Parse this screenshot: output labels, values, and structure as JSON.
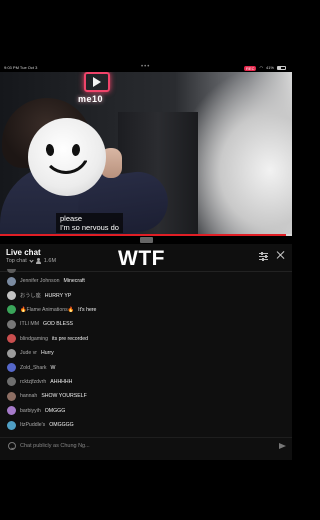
{
  "status_bar": {
    "time_date": "9:03 PM  Tue Oct 3",
    "record_badge": "REC",
    "battery": "41%"
  },
  "video": {
    "neon_sign": "me10",
    "caption_lines": [
      "please",
      "I'm so nervous do"
    ],
    "progress_fraction": 0.98
  },
  "chat": {
    "title": "Live chat",
    "mode_label": "Top chat",
    "viewer_count": "1.6M",
    "overlay_text": "WTF",
    "input_placeholder": "Chat publicly as Chung Ng...",
    "messages": [
      {
        "name": "",
        "text": "",
        "avatar_color": "#5a5a5a",
        "partial": true
      },
      {
        "name": "Jennifer Johnson",
        "text": "Minecraft",
        "avatar_color": "#7b8ba1"
      },
      {
        "name": "おうし座",
        "text": "HURRY YP",
        "avatar_color": "#c2c2c2"
      },
      {
        "name": "🔥Flame Animations🔥",
        "text": "It's here",
        "avatar_color": "#3aa55a"
      },
      {
        "name": "ITLI MM",
        "text": "GOD BLESS",
        "avatar_color": "#777777"
      },
      {
        "name": "blindgaming",
        "text": "its pre recorded",
        "avatar_color": "#c94e4e"
      },
      {
        "name": "Jude vr",
        "text": "Hurry",
        "avatar_color": "#9b9b9b"
      },
      {
        "name": "Zold_Shark",
        "text": "W",
        "avatar_color": "#5567c9"
      },
      {
        "name": "rcktzjfzdvrh",
        "text": "AHHHHH",
        "avatar_color": "#6e6e6e"
      },
      {
        "name": "hannah",
        "text": "SHOW YOURSELF",
        "avatar_color": "#8d6e63"
      },
      {
        "name": "barbiyyih",
        "text": "OMGGG",
        "avatar_color": "#a57ac9"
      },
      {
        "name": "ItzPuddle's",
        "text": "OMGGGG",
        "avatar_color": "#4f9fc4"
      }
    ]
  }
}
